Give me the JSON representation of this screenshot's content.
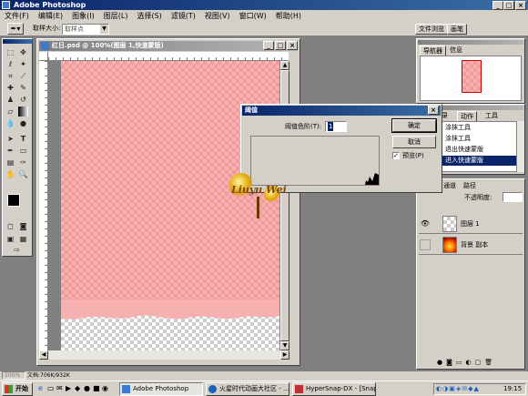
{
  "app": {
    "title": "Adobe Photoshop"
  },
  "menu": [
    "文件(F)",
    "编辑(E)",
    "图象(I)",
    "图层(L)",
    "选择(S)",
    "滤镜(T)",
    "视图(V)",
    "窗口(W)",
    "帮助(H)"
  ],
  "options_bar": {
    "label": "取样大小:",
    "value": "取样点",
    "palette_tabs": [
      "文件浏览",
      "画笔"
    ]
  },
  "document": {
    "title": "红日.psd @ 100%(图层 1,快速蒙版)"
  },
  "navigator": {
    "tabs": [
      "导航器",
      "信息"
    ]
  },
  "history": {
    "tabs": [
      "历史记录",
      "动作",
      "工具"
    ],
    "items": [
      "涂抹工具",
      "涂抹工具",
      "退出快速蒙版",
      "进入快速蒙版"
    ]
  },
  "dialog": {
    "title": "阈值",
    "label": "阈值色阶(T):",
    "value": "1",
    "ok": "确定",
    "cancel": "取消",
    "preview": "预览(P)",
    "preview_checked": true
  },
  "layers": {
    "tabs": [
      "通道",
      "路径"
    ],
    "opacity_label": "不透明度:",
    "items": [
      "图层 1",
      "背景 副本"
    ]
  },
  "watermark": {
    "text": "Liuyu Wei"
  },
  "status": {
    "zoom": "100%",
    "doc": "文档:706K/932K"
  },
  "taskbar": {
    "start": "开始",
    "buttons": [
      "Adobe Photoshop",
      "火星时代动画大社区 - ...",
      "HyperSnap-DX - [Snap6.j..."
    ],
    "clock": "19:15"
  },
  "colors": {
    "titlebar": "#0a246a",
    "selection": "#0a246a",
    "canvas_pink": "#f6b0b0",
    "chrome": "#d4d0c8"
  }
}
